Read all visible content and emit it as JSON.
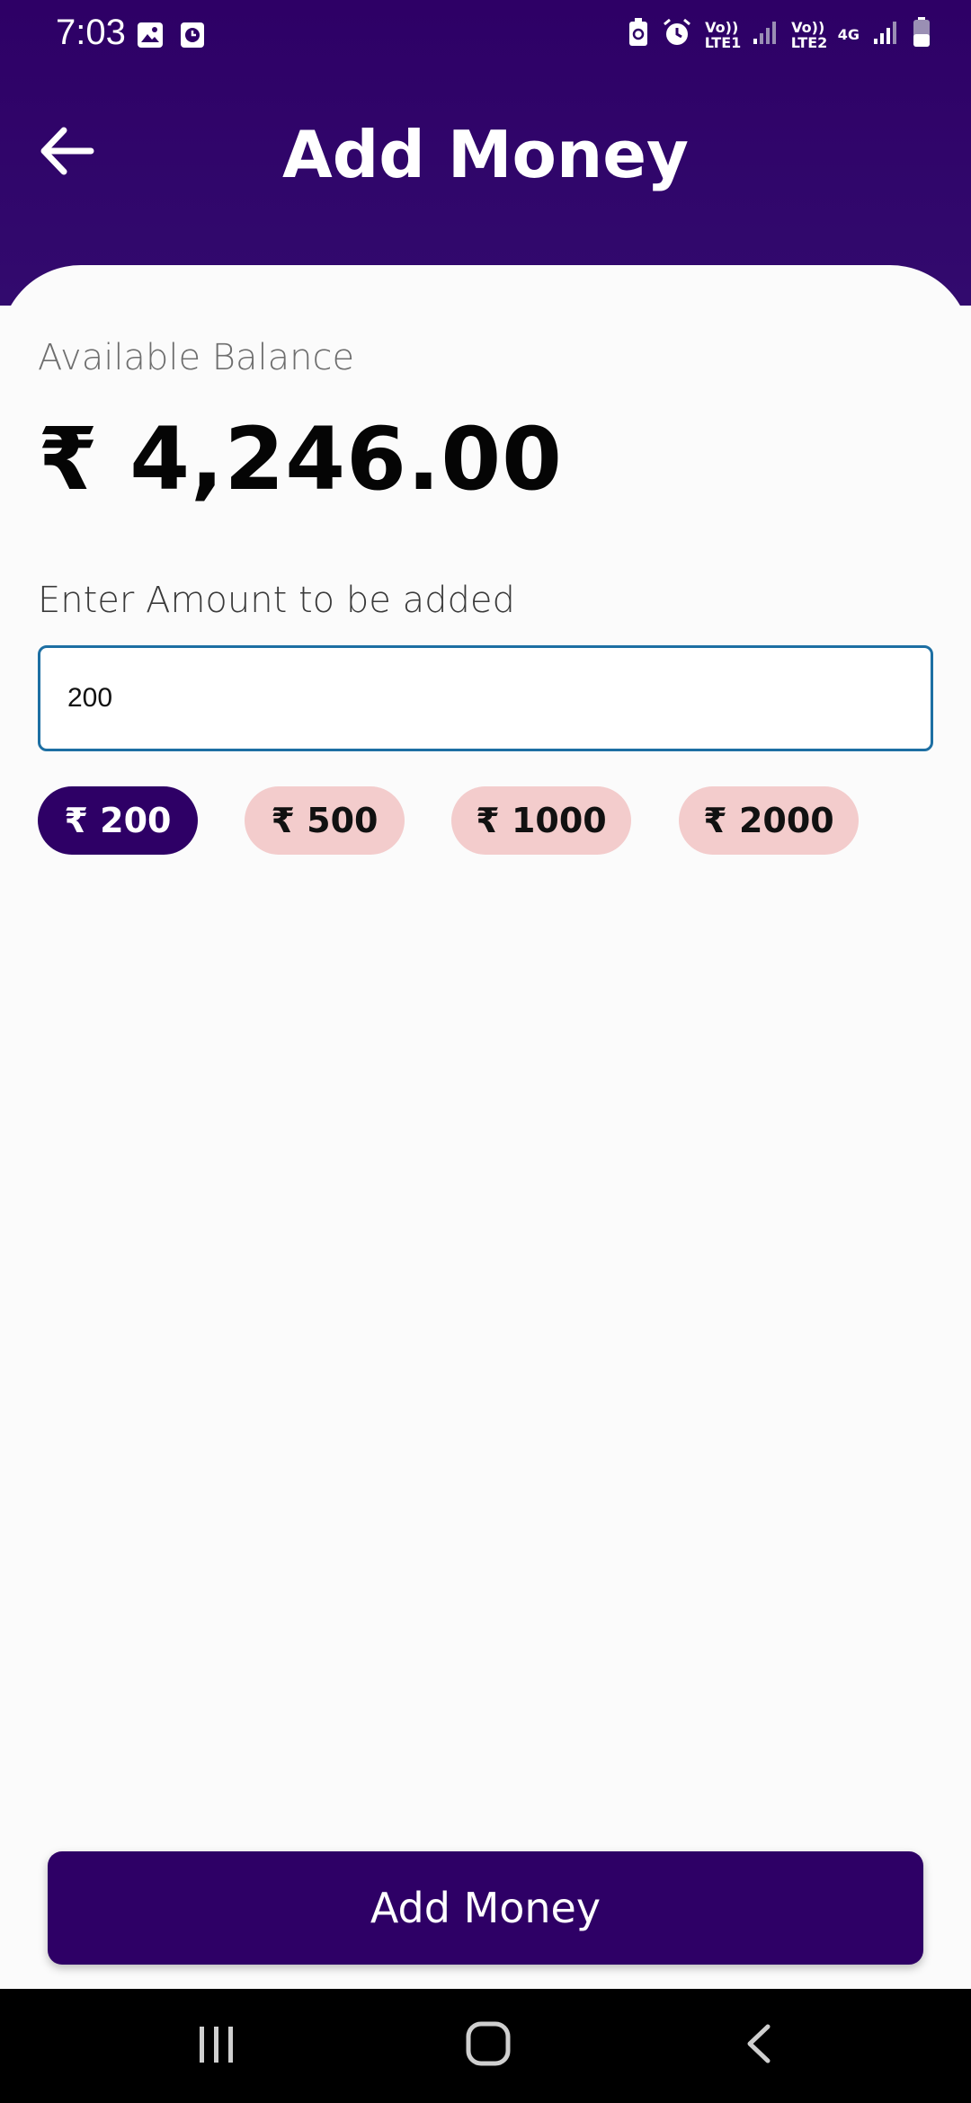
{
  "status_bar": {
    "time": "7:03",
    "left_icons": [
      "image-icon",
      "clock-app-icon"
    ],
    "right_icons": [
      "battery-saver-icon",
      "alarm-icon",
      "signal-sim1-icon",
      "signal-sim2-icon",
      "battery-icon"
    ],
    "sim1_label": "Vo)) LTE1",
    "sim2_label": "Vo)) LTE2",
    "network_type": "4G"
  },
  "header": {
    "title": "Add Money",
    "back_icon": "arrow-left-icon"
  },
  "balance": {
    "label": "Available Balance",
    "value": "₹ 4,246.00"
  },
  "amount": {
    "label": "Enter Amount to be added",
    "value": "200"
  },
  "quick_amounts": [
    {
      "label": "₹ 200",
      "selected": true
    },
    {
      "label": "₹ 500",
      "selected": false
    },
    {
      "label": "₹ 1000",
      "selected": false
    },
    {
      "label": "₹ 2000",
      "selected": false
    }
  ],
  "primary_button": {
    "label": "Add Money"
  },
  "colors": {
    "brand": "#2e0066",
    "chip_unselected": "#f3cccc",
    "input_border": "#1d6fa3",
    "background": "#fbfbfb"
  },
  "nav_bar": {
    "items": [
      "recent-apps-icon",
      "home-icon",
      "back-icon"
    ]
  }
}
